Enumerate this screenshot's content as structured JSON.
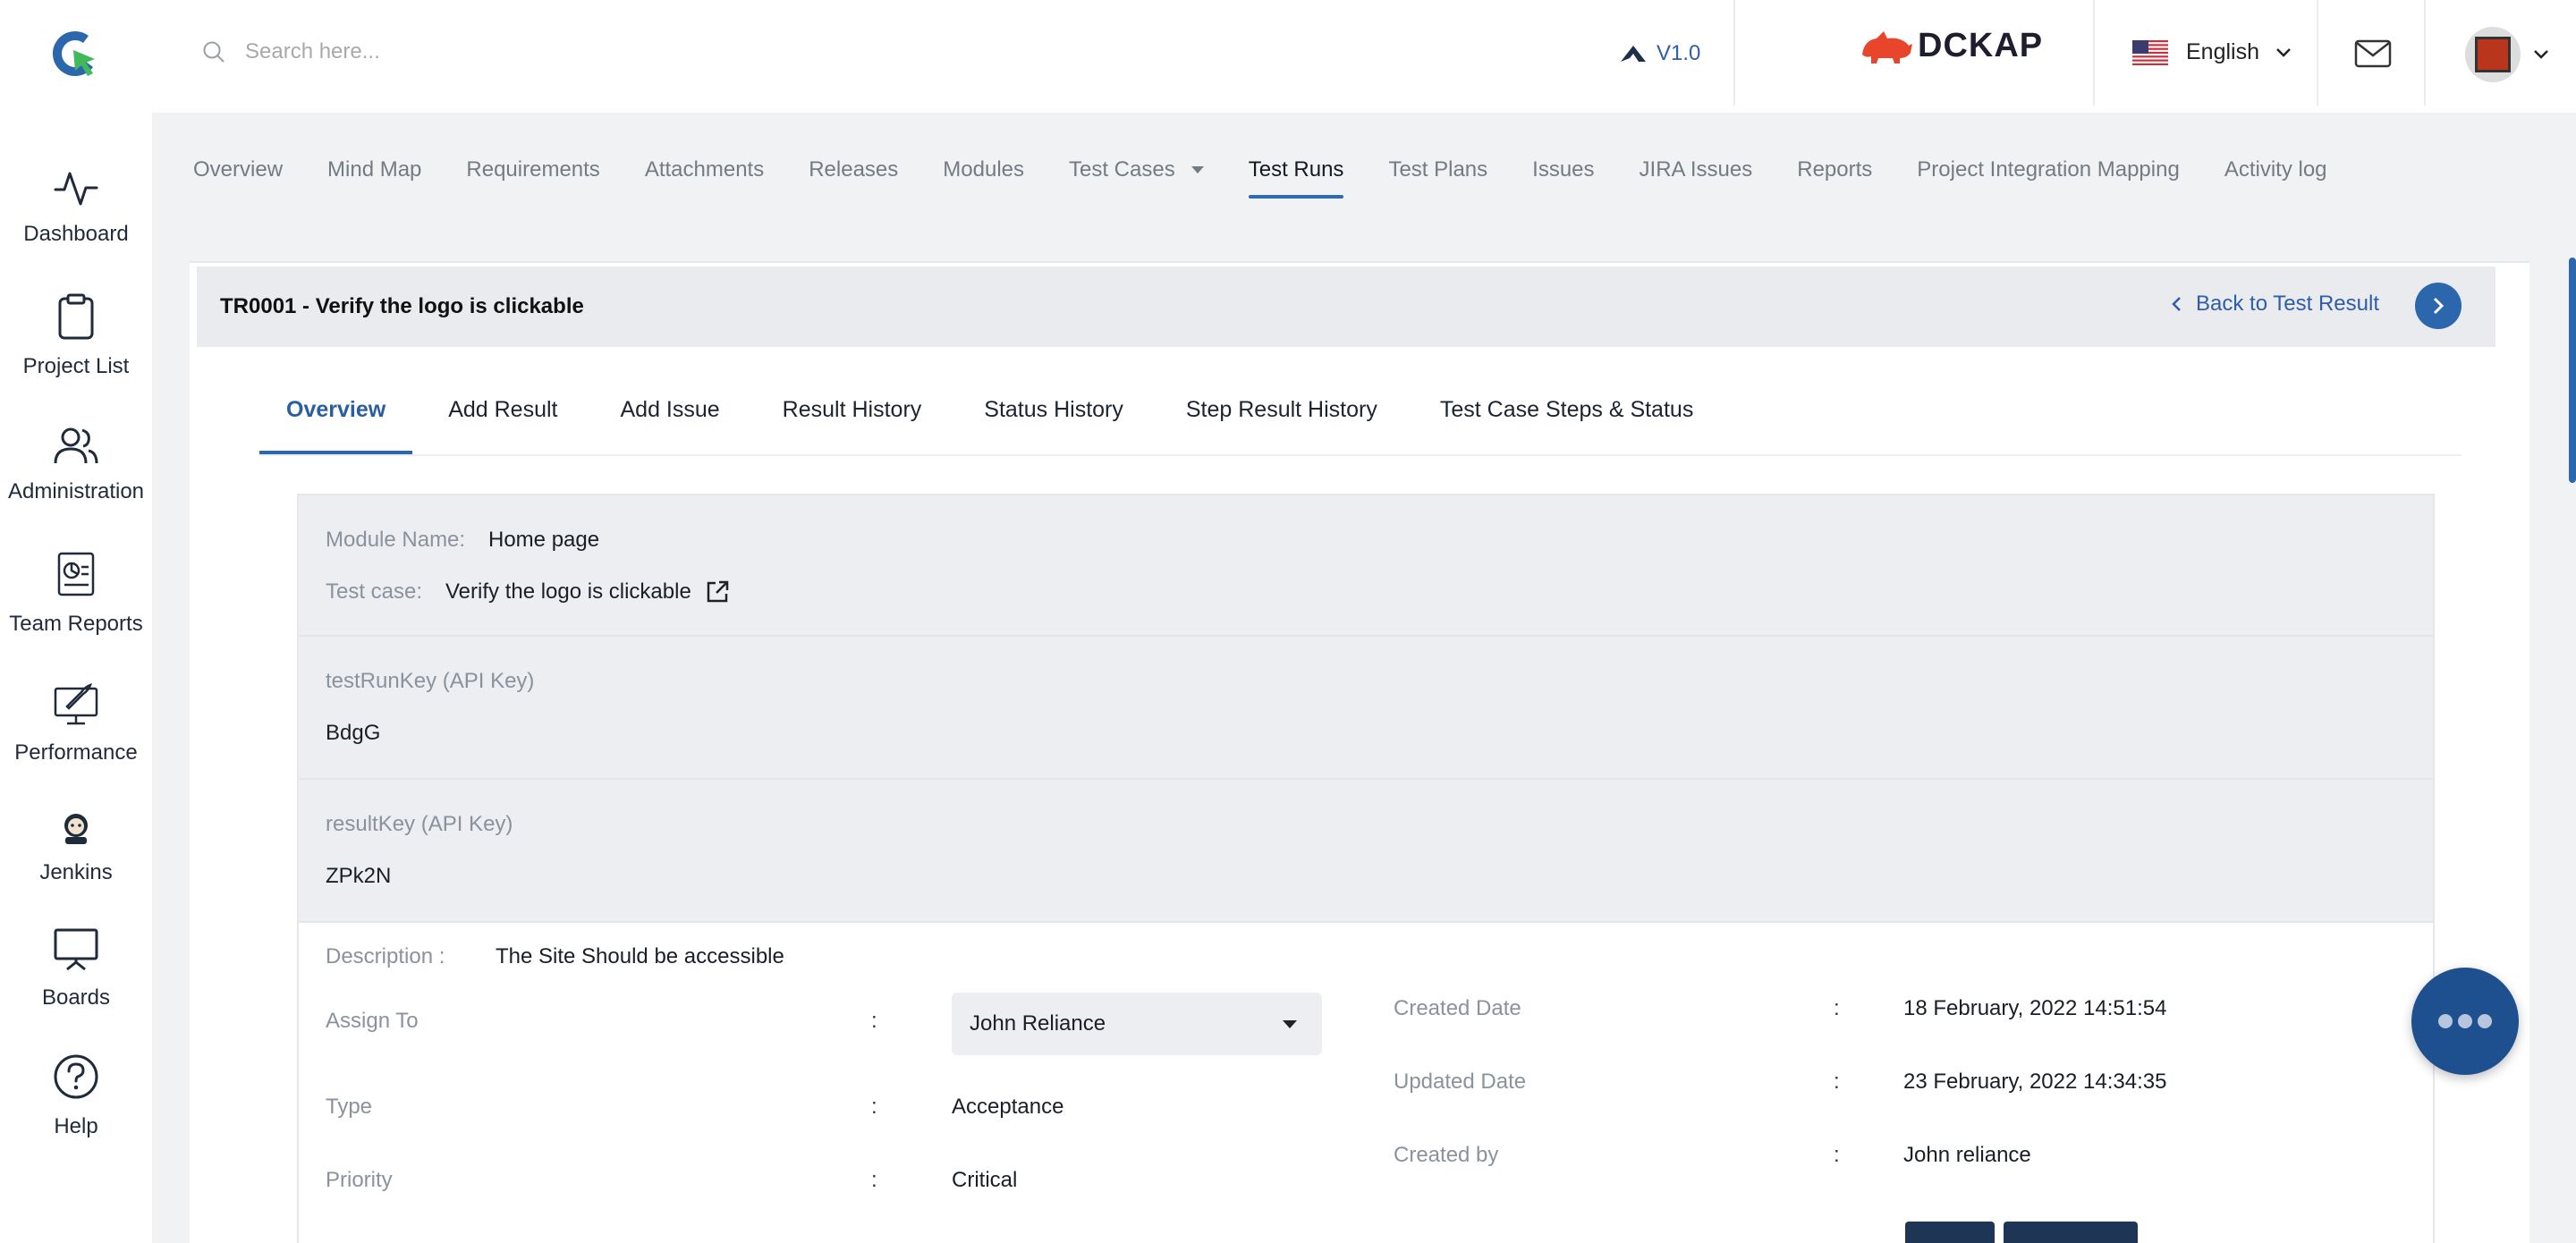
{
  "header": {
    "search_placeholder": "Search here...",
    "version": "V1.0",
    "brand": "DCKAP",
    "language": "English",
    "brand_color": "#e8452c",
    "accent": "#2c66ad"
  },
  "sidebar": {
    "items": [
      {
        "label": "Dashboard",
        "icon": "activity-icon"
      },
      {
        "label": "Project List",
        "icon": "clipboard-icon"
      },
      {
        "label": "Administration",
        "icon": "users-icon"
      },
      {
        "label": "Team Reports",
        "icon": "report-icon"
      },
      {
        "label": "Performance",
        "icon": "rocket-monitor-icon"
      },
      {
        "label": "Jenkins",
        "icon": "jenkins-icon"
      },
      {
        "label": "Boards",
        "icon": "presentation-board-icon"
      },
      {
        "label": "Help",
        "icon": "help-circle-icon"
      }
    ]
  },
  "topnav": {
    "items": [
      "Overview",
      "Mind Map",
      "Requirements",
      "Attachments",
      "Releases",
      "Modules",
      "Test Cases",
      "Test Runs",
      "Test Plans",
      "Issues",
      "JIRA Issues",
      "Reports",
      "Project Integration Mapping",
      "Activity log"
    ],
    "active": "Test Runs"
  },
  "card": {
    "title": "TR0001 - Verify the logo is clickable",
    "back_label": "Back to Test Result"
  },
  "tabs": {
    "items": [
      "Overview",
      "Add Result",
      "Add Issue",
      "Result History",
      "Status History",
      "Step Result History",
      "Test Case Steps & Status"
    ],
    "active": "Overview"
  },
  "overview": {
    "module_label": "Module Name:",
    "module_value": "Home page",
    "testcase_label": "Test case:",
    "testcase_value": "Verify the logo is clickable",
    "testrunkey_label": "testRunKey (API Key)",
    "testrunkey_value": "BdgG",
    "resultkey_label": "resultKey (API Key)",
    "resultkey_value": "ZPk2N",
    "description_label": "Description :",
    "description_value": "The Site Should be accessible",
    "assign_label": "Assign To",
    "assign_value": "John Reliance",
    "type_label": "Type",
    "type_value": "Acceptance",
    "priority_label": "Priority",
    "priority_value": "Critical",
    "created_date_label": "Created Date",
    "created_date_value": "18 February, 2022 14:51:54",
    "updated_date_label": "Updated Date",
    "updated_date_value": "23 February, 2022 14:34:35",
    "created_by_label": "Created by",
    "created_by_value": "John reliance",
    "colon": ":"
  }
}
